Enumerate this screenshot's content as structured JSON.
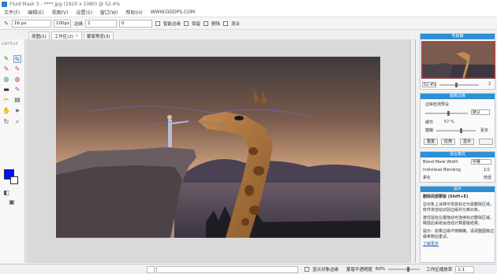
{
  "window": {
    "title": "Fluid Mask 3 - ****.jpg (1920 x 1080) @ 52.4%"
  },
  "menu": [
    "文件(F)",
    "编辑(E)",
    "视图(V)",
    "设置(S)",
    "窗口(W)",
    "帮助(H)",
    "WWW.DDDPS.COM"
  ],
  "toolbar": {
    "brush_size": "16 px",
    "brush_field2": "100px",
    "edge_label": "边缘",
    "edge_value": "2",
    "field3": "0",
    "smart_label": "智能边缘",
    "check1": "保留",
    "check2": "删除",
    "check3": "混合"
  },
  "tabs": [
    {
      "label": "原图(1)",
      "active": false
    },
    {
      "label": "工作区(2)",
      "active": true
    },
    {
      "label": "蒙版预览(3)",
      "active": false
    }
  ],
  "toolbox": {
    "logo": "vertus"
  },
  "panels": {
    "nav": {
      "title": "导航器",
      "zoom": "52.4%",
      "v2": "2"
    },
    "edge": {
      "title": "图像边缘",
      "preset_label": "边缘检测预设",
      "preset_value": "默认",
      "detail_label": "细节",
      "detail_value": "57 %",
      "blur_label": "模糊",
      "less": "较少",
      "more": "更多",
      "btn1": "重置",
      "btn2": "应用",
      "btn3": "显示"
    },
    "blend": {
      "title": "混合模式",
      "mode_label": "Blend Mask Width",
      "mode_value": "中等",
      "fine_label": "Individual Blending",
      "fine_value": "1/2",
      "soft_label": "柔化",
      "soft_value": "较低"
    },
    "help": {
      "title": "提示",
      "heading": "删除局部蒙版 (Shift+E)",
      "p1": "在对象上涂抹可将其标记为需删除区域，软件将自动识别边缘并分离对象。",
      "p2": "按住鼠标左键拖动可连续标记删除区域，释放后系统会自动计算蒙版结果。",
      "p3": "提示：如果边缘不够精确，请调整图像边缘参数后重试。",
      "link": "了解更多"
    }
  },
  "status": {
    "checkbox_label": "显示对象边缘",
    "opacity_label": "蒙版不透明度",
    "opacity_value": "60%",
    "zoom_label": "工作区缩放率",
    "zoom_value": "1:1"
  },
  "colors": {
    "accent": "#2d8fd6",
    "foreground": "#0010ff",
    "background": "#ffffff"
  }
}
